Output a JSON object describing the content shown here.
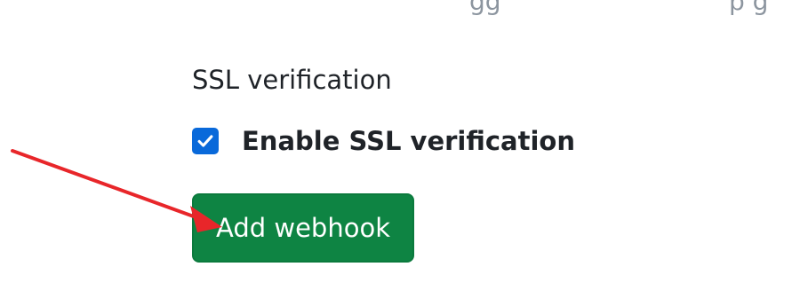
{
  "ssl": {
    "section_title": "SSL verification",
    "checkbox_label": "Enable SSL verification",
    "checkbox_checked": true
  },
  "actions": {
    "add_webhook_label": "Add webhook"
  },
  "colors": {
    "checkbox_blue": "#0969da",
    "button_green": "#0e8443",
    "annotation_red": "#e8262a"
  },
  "icons": {
    "checkbox": "checkmark-icon",
    "annotation": "red-arrow-icon"
  }
}
